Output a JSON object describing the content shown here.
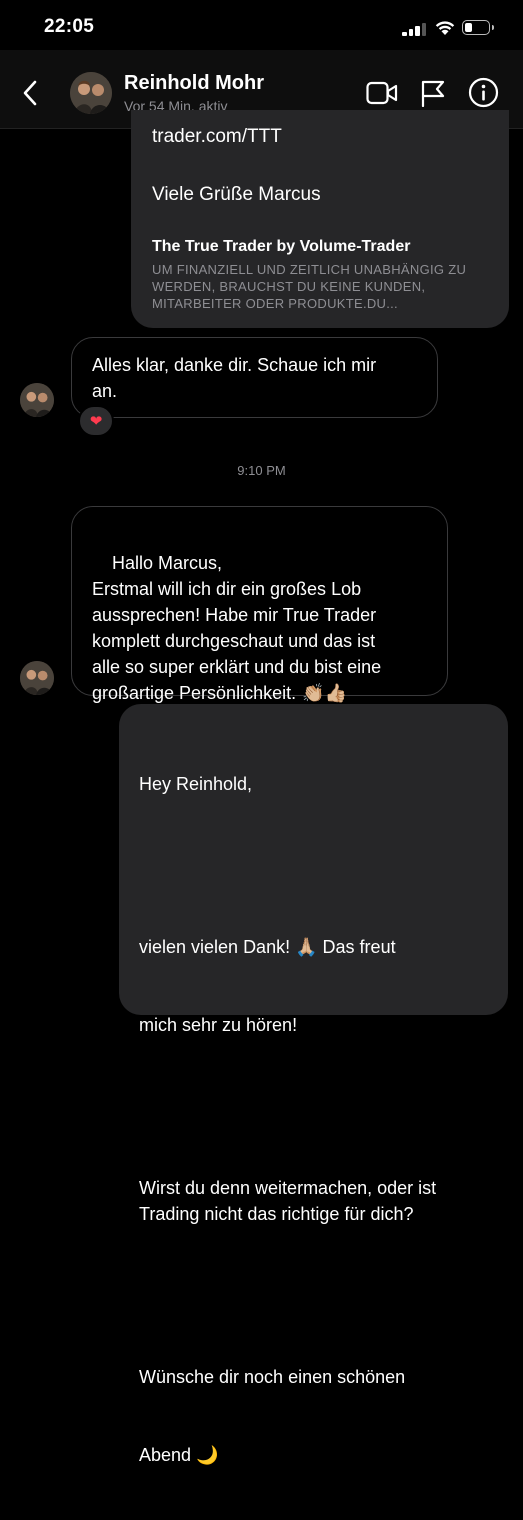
{
  "status_bar": {
    "time": "22:05"
  },
  "header": {
    "name": "Reinhold Mohr",
    "status": "Vor 54 Min. aktiv",
    "icons": [
      "back-chevron-icon",
      "video-call-icon",
      "flag-icon",
      "info-icon"
    ]
  },
  "messages": {
    "link_card": {
      "link_text": "trader.com/TTT",
      "greeting": "Viele Grüße Marcus",
      "preview_title": "The True Trader by Volume-Trader",
      "preview_desc": "UM FINANZIELL UND ZEITLICH UNABHÄNGIG ZU WERDEN, BRAUCHST DU KEINE KUNDEN, MITARBEITER ODER PRODUKTE.DU..."
    },
    "incoming_1": {
      "text": "Alles klar, danke dir. Schaue ich mir\nan.",
      "reaction": "❤"
    },
    "timestamp": "9:10 PM",
    "incoming_2": {
      "text": "Hallo Marcus,\nErstmal will ich dir ein großes Lob\naussprechen! Habe mir True Trader\nkomplett durchgeschaut und das ist\nalle so super erklärt und du bist eine\ngroßartige Persönlichkeit.",
      "emoji": "👏🏼👍🏼"
    },
    "outgoing_1": {
      "line1": "Hey Reinhold,",
      "line2a": "vielen vielen Dank!",
      "line2_emoji": "🙏🏼",
      "line2b": "Das freut",
      "line3": "mich sehr zu hören!",
      "para3": "Wirst du denn weitermachen, oder ist\nTrading nicht das richtige für dich?",
      "para4a": "Wünsche dir noch einen schönen",
      "para4b": "Abend",
      "para4_emoji": "🌙"
    }
  },
  "colors": {
    "background": "#000000",
    "bubble_out": "#262628",
    "bubble_in_border": "#3a3a3c",
    "muted": "#8e8e93"
  }
}
